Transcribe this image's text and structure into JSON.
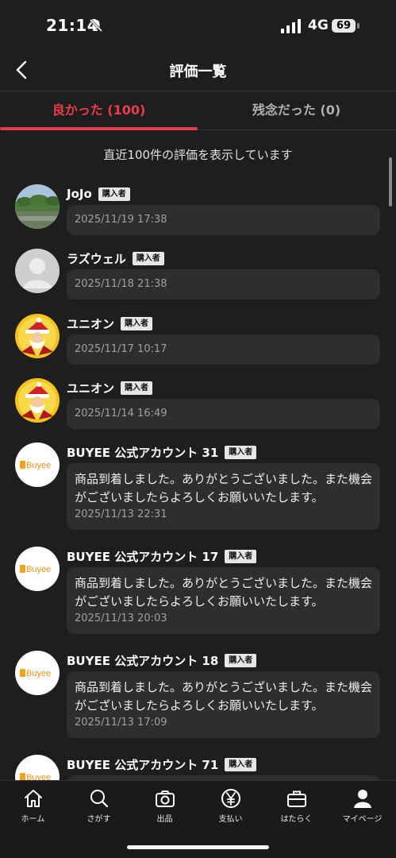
{
  "status_bar": {
    "time": "21:14",
    "network": "4G",
    "battery": "69"
  },
  "header": {
    "title": "評価一覧"
  },
  "tabs": [
    {
      "label": "良かった (100)",
      "active": true
    },
    {
      "label": "残念だった (0)",
      "active": false
    }
  ],
  "notice": "直近100件の評価を表示しています",
  "reviews": [
    {
      "name": "JoJo",
      "badge": "購入者",
      "message": "",
      "date": "2025/11/19 17:38",
      "avatar": "landscape-photo"
    },
    {
      "name": "ラズウェル",
      "badge": "購入者",
      "message": "",
      "date": "2025/11/18 21:38",
      "avatar": "default-person"
    },
    {
      "name": "ユニオン",
      "badge": "購入者",
      "message": "",
      "date": "2025/11/17 10:17",
      "avatar": "santa-cartoon"
    },
    {
      "name": "ユニオン",
      "badge": "購入者",
      "message": "",
      "date": "2025/11/14 16:49",
      "avatar": "santa-cartoon"
    },
    {
      "name": "BUYEE 公式アカウント 31",
      "badge": "購入者",
      "message": "商品到着しました。ありがとうございました。また機会がございましたらよろしくお願いいたします。",
      "date": "2025/11/13 22:31",
      "avatar": "buyee-logo"
    },
    {
      "name": "BUYEE 公式アカウント 17",
      "badge": "購入者",
      "message": "商品到着しました。ありがとうございました。また機会がございましたらよろしくお願いいたします。",
      "date": "2025/11/13 20:03",
      "avatar": "buyee-logo"
    },
    {
      "name": "BUYEE 公式アカウント 18",
      "badge": "購入者",
      "message": "商品到着しました。ありがとうございました。また機会がございましたらよろしくお願いいたします。",
      "date": "2025/11/13 17:09",
      "avatar": "buyee-logo"
    },
    {
      "name": "BUYEE 公式アカウント 71",
      "badge": "購入者",
      "message": "",
      "date": "",
      "avatar": "buyee-logo"
    }
  ],
  "buyee_logo_text": "Buyee",
  "bottom_nav": [
    {
      "label": "ホーム",
      "icon": "home-icon"
    },
    {
      "label": "さがす",
      "icon": "search-icon"
    },
    {
      "label": "出品",
      "icon": "camera-icon"
    },
    {
      "label": "支払い",
      "icon": "yen-icon"
    },
    {
      "label": "はたらく",
      "icon": "briefcase-icon"
    },
    {
      "label": "マイページ",
      "icon": "person-icon"
    }
  ],
  "colors": {
    "accent": "#e23c4c",
    "background": "#1e1e1e",
    "bubble": "#2e2e2e"
  }
}
